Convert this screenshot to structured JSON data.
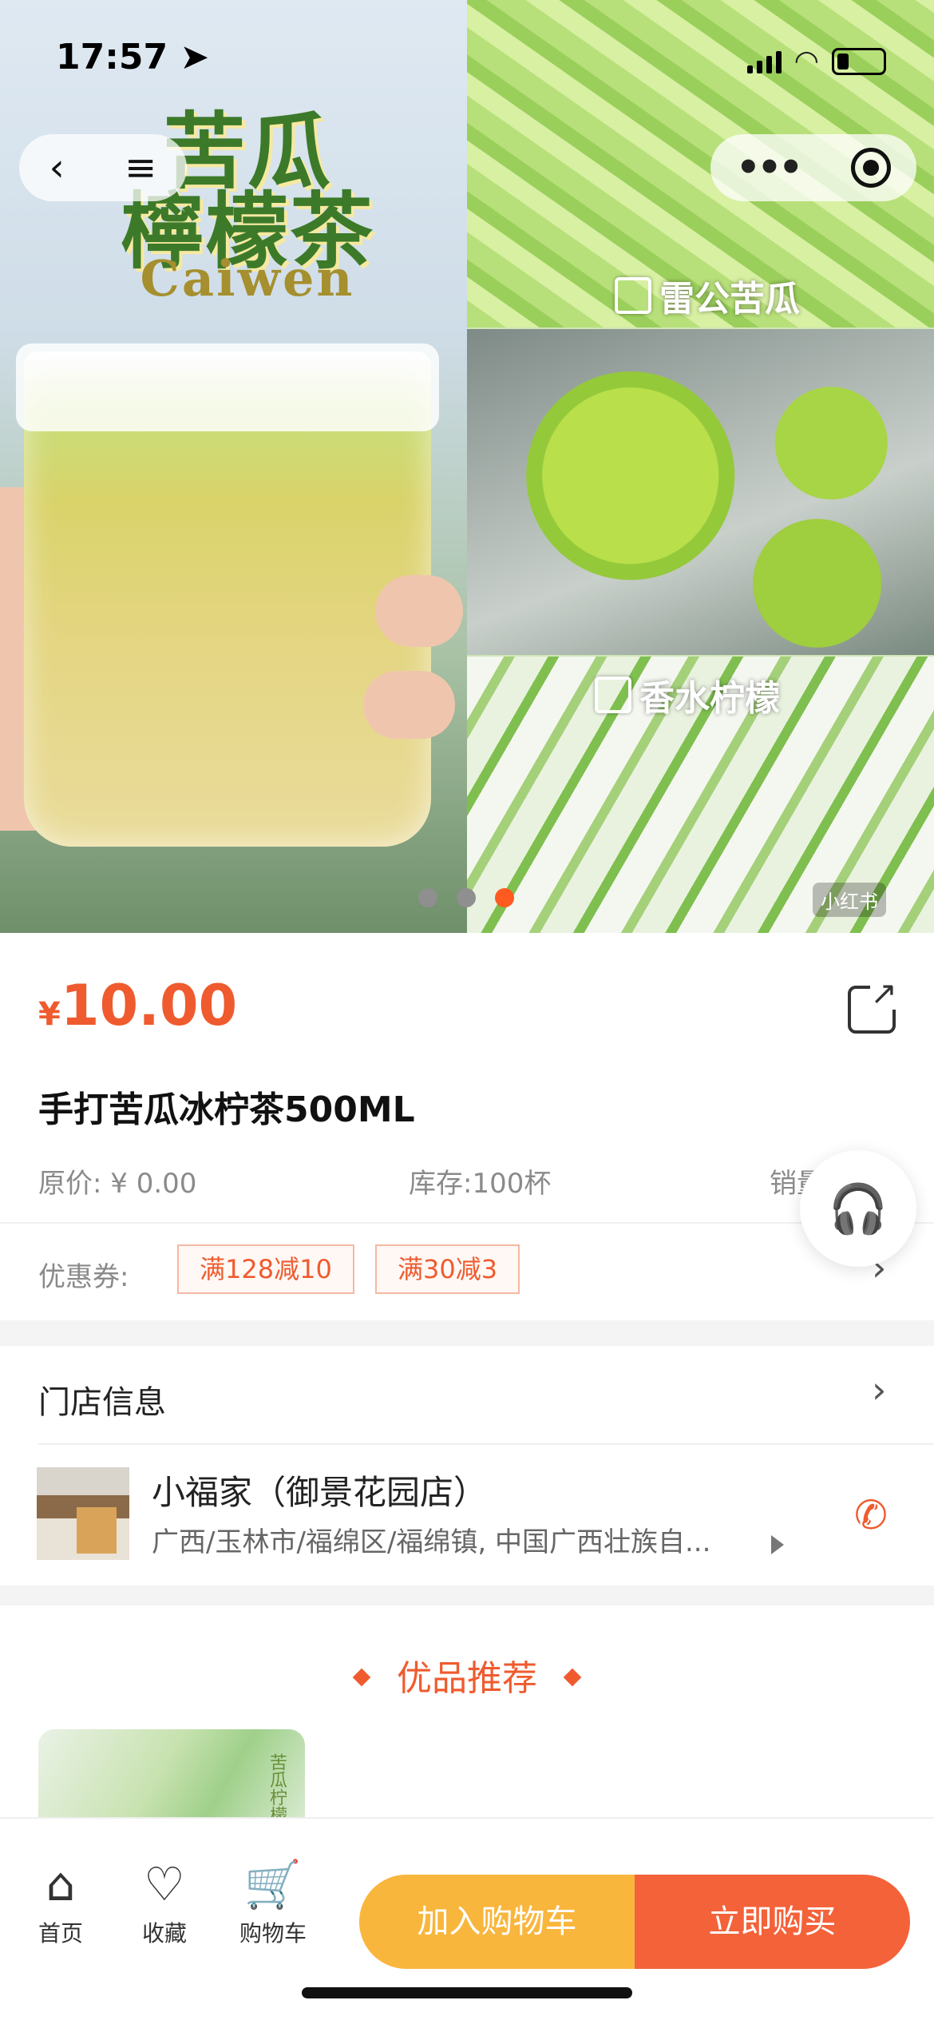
{
  "status_bar": {
    "time": "17:57"
  },
  "hero": {
    "title_line1": "苦瓜",
    "title_line2": "檸檬茶",
    "subtitle": "Caiwen",
    "panel1_tag": "雷公苦瓜",
    "panel3_tag": "香水柠檬",
    "watermark": "小红书",
    "page_count": 3,
    "active_page": 3
  },
  "product": {
    "currency": "¥",
    "price": "10.00",
    "name": "手打苦瓜冰柠茶500ML",
    "original_price": "原价: ¥ 0.00",
    "stock": "库存:100杯",
    "sales": "销量",
    "coupon_label": "优惠券:",
    "coupons": [
      "满128减10",
      "满30减3"
    ]
  },
  "store": {
    "section_title": "门店信息",
    "name": "小福家（御景花园店）",
    "address": "广西/玉林市/福绵区/福绵镇, 中国广西壮族自..."
  },
  "recommend": {
    "title": "优品推荐",
    "card_text": "苦瓜柠檬汁"
  },
  "bottom_bar": {
    "tabs": [
      {
        "label": "首页",
        "icon": "home-icon"
      },
      {
        "label": "收藏",
        "icon": "heart-icon"
      },
      {
        "label": "购物车",
        "icon": "cart-icon"
      }
    ],
    "add_to_cart": "加入购物车",
    "buy_now": "立即购买"
  },
  "colors": {
    "accent": "#ef5b2e",
    "cart_button": "#f9b63d",
    "buy_button": "#f4623a"
  }
}
